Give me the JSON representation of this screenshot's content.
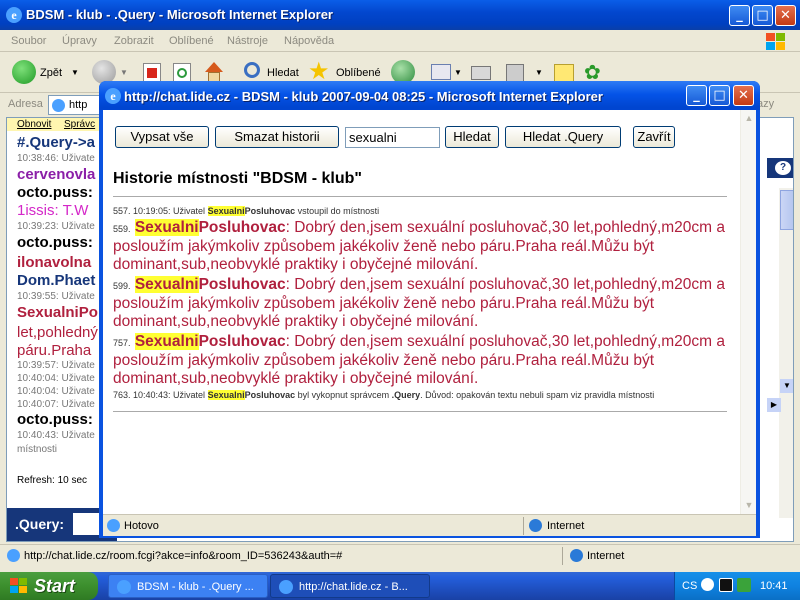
{
  "main_window": {
    "title": "BDSM - klub - .Query - Microsoft Internet Explorer",
    "menu": [
      "Soubor",
      "Úpravy",
      "Zobrazit",
      "Oblíbené",
      "Nástroje",
      "Nápověda"
    ],
    "toolbar": {
      "back": "Zpět",
      "search": "Hledat",
      "favorites": "Oblíbené"
    },
    "address_label": "Adresa",
    "address_value": "http",
    "go_label": "azy",
    "statusbar_url": "http://chat.lide.cz/room.fcgi?akce=info&room_ID=536243&auth=#",
    "statusbar_zone": "Internet"
  },
  "chat": {
    "links": [
      "Obnovit",
      "Správc"
    ],
    "lines": [
      {
        "text": "#.Query->a",
        "color": "#16367a",
        "kind": "nick"
      },
      {
        "text": "10:38:46: Uživate",
        "kind": "small"
      },
      {
        "text": "cervenovla",
        "color": "#8b1fa8",
        "kind": "nick"
      },
      {
        "text": "octo.puss:",
        "color": "#000000",
        "kind": "nick"
      },
      {
        "text": "1issis: T.W",
        "color": "#d428c8",
        "kind": "body"
      },
      {
        "text": "10:39:23: Uživate",
        "kind": "small"
      },
      {
        "text": "octo.puss:",
        "color": "#000000",
        "kind": "nick"
      },
      {
        "text": "ilonavolna",
        "color": "#b0203e",
        "kind": "nick"
      },
      {
        "text": "Dom.Phaet",
        "color": "#16367a",
        "kind": "nick"
      },
      {
        "text": "10:39:55: Uživate",
        "kind": "small"
      },
      {
        "text": "SexualniPo",
        "color": "#b0203e",
        "kind": "nick"
      },
      {
        "text": "let,pohledný",
        "color": "#b0203e",
        "kind": "body"
      },
      {
        "text": "páru.Praha",
        "color": "#b0203e",
        "kind": "body"
      },
      {
        "text": "10:39:57: Uživate",
        "kind": "small"
      },
      {
        "text": "10:40:04: Uživate",
        "kind": "small"
      },
      {
        "text": "10:40:04: Uživate",
        "kind": "small"
      },
      {
        "text": "10:40:07: Uživate",
        "kind": "small"
      },
      {
        "text": "octo.puss:",
        "color": "#000000",
        "kind": "nick"
      },
      {
        "text": "10:40:43: Uživate",
        "kind": "small"
      },
      {
        "text": "místnosti",
        "kind": "small"
      }
    ],
    "refresh": "Refresh: 10 sec",
    "query_label": ".Query:"
  },
  "popup": {
    "title": "http://chat.lide.cz - BDSM - klub 2007-09-04 08:25 - Microsoft Internet Explorer",
    "buttons": {
      "list_all": "Vypsat vše",
      "clear_history": "Smazat historii",
      "search": "Hledat",
      "search_query": "Hledat .Query",
      "close": "Zavřít"
    },
    "search_value": "sexualni",
    "heading": "Historie místnosti \"BDSM - klub\"",
    "entries": [
      {
        "type": "sys",
        "prefix": "557. 10:19:05: Uživatel ",
        "nick_hl": "Sexualni",
        "nick_rest": "Posluhovac",
        "suffix": " vstoupil do místnosti"
      },
      {
        "type": "msg",
        "id": "559.",
        "nick_hl": "Sexualni",
        "nick_rest": "Posluhovac",
        "text": ": Dobrý den,jsem sexuální posluhovač,30 let,pohledný,m20cm a posloužím jakýmkoliv způsobem jakékoliv ženě nebo páru.Praha reál.Můžu být dominant,sub,neobvyklé praktiky i obyčejné milování."
      },
      {
        "type": "msg",
        "id": "599.",
        "nick_hl": "Sexualni",
        "nick_rest": "Posluhovac",
        "text": ": Dobrý den,jsem sexuální posluhovač,30 let,pohledný,m20cm a posloužím jakýmkoliv způsobem jakékoliv ženě nebo páru.Praha reál.Můžu být dominant,sub,neobvyklé praktiky i obyčejné milování."
      },
      {
        "type": "msg",
        "id": "757.",
        "nick_hl": "Sexualni",
        "nick_rest": "Posluhovac",
        "text": ": Dobrý den,jsem sexuální posluhovač,30 let,pohledný,m20cm a posloužím jakýmkoliv způsobem jakékoliv ženě nebo páru.Praha reál.Můžu být dominant,sub,neobvyklé praktiky i obyčejné milování."
      },
      {
        "type": "sys",
        "prefix": "763. 10:40:43: Uživatel ",
        "nick_hl": "Sexualni",
        "nick_rest": "Posluhovac",
        "suffix": " byl vykopnut správcem ",
        "suffix_bold": ".Query",
        "suffix2": ". Důvod: opakován textu nebuli spam viz pravidla místnosti"
      }
    ],
    "status_text": "Hotovo",
    "status_zone": "Internet"
  },
  "taskbar": {
    "start": "Start",
    "tasks": [
      "BDSM - klub - .Query ...",
      "http://chat.lide.cz - B..."
    ],
    "lang": "CS",
    "clock": "10:41"
  }
}
